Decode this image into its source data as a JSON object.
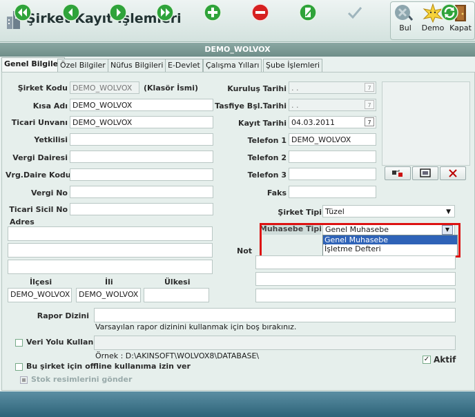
{
  "app": {
    "title": "Şirket Kayıt İşlemleri"
  },
  "toolbar": {
    "bul": "Bul",
    "demo": "Demo",
    "kapat": "Kapat"
  },
  "banner": "DEMO_WOLVOX",
  "tabs": [
    "Genel Bilgiler",
    "Özel Bilgiler",
    "Nüfus Bilgileri",
    "E-Devlet",
    "Çalışma Yılları",
    "Şube İşlemleri"
  ],
  "left": {
    "sirket_kodu_label": "Şirket Kodu",
    "sirket_kodu_value": "DEMO_WOLVOX",
    "klasor_ismi": "(Klasör İsmi)",
    "kisa_adi_label": "Kısa Adı",
    "kisa_adi_value": "DEMO_WOLVOX",
    "ticari_unvani_label": "Ticari Unvanı",
    "ticari_unvani_value": "DEMO_WOLVOX",
    "yetkilisi_label": "Yetkilisi",
    "vergi_dairesi_label": "Vergi Dairesi",
    "vrg_daire_kodu_label": "Vrg.Daire Kodu",
    "vergi_no_label": "Vergi No",
    "ticari_sicil_no_label": "Ticari Sicil No",
    "adres_label": "Adres",
    "ilcesi_label": "İlçesi",
    "ilcesi_value": "DEMO_WOLVOX",
    "ili_label": "İli",
    "ili_value": "DEMO_WOLVOX",
    "ulkesi_label": "Ülkesi"
  },
  "right": {
    "kurulus_tarihi_label": "Kuruluş Tarihi",
    "kurulus_tarihi_value": ". .",
    "tasfiye_label": "Tasfiye Bşl.Tarihi",
    "tasfiye_value": ". .",
    "kayit_tarihi_label": "Kayıt Tarihi",
    "kayit_tarihi_value": "04.03.2011",
    "telefon1_label": "Telefon 1",
    "telefon1_value": "DEMO_WOLVOX",
    "telefon2_label": "Telefon 2",
    "telefon3_label": "Telefon 3",
    "faks_label": "Faks",
    "sirket_tipi_label": "Şirket Tipi",
    "sirket_tipi_value": "Tüzel",
    "muhasebe_tipi_label": "Muhasebe Tipi",
    "muhasebe_tipi_value": "Genel Muhasebe",
    "muhasebe_options": [
      "Genel Muhasebe",
      "İşletme Defteri"
    ],
    "not_label": "Not"
  },
  "bottom_form": {
    "rapor_dizini_label": "Rapor Dizini",
    "rapor_hint": "Varsayılan rapor dizinini kullanmak için boş bırakınız.",
    "veri_yolu_label": "Veri Yolu Kullan",
    "ornek": "Örnek : D:\\AKINSOFT\\WOLVOX8\\DATABASE\\",
    "offline_label": "Bu şirket için offline kullanıma izin ver",
    "stok_label": "Stok resimlerini gönder",
    "aktif_label": "Aktif"
  },
  "colors": {
    "accent": "#2f63b8",
    "highlight": "#dd1111",
    "nav_green": "#2fa33a",
    "nav_red": "#d62020"
  }
}
